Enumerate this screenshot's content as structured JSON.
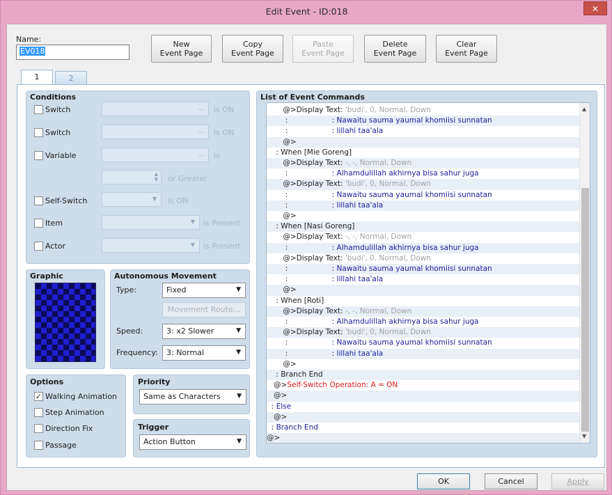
{
  "window": {
    "title": "Edit Event - ID:018",
    "close_glyph": "✕"
  },
  "name": {
    "label": "Name:",
    "value": "EV018"
  },
  "toolbar": {
    "new_page": "New\nEvent Page",
    "copy_page": "Copy\nEvent Page",
    "paste_page": "Paste\nEvent Page",
    "delete_page": "Delete\nEvent Page",
    "clear_page": "Clear\nEvent Page"
  },
  "tabs": [
    {
      "label": "1",
      "active": true
    },
    {
      "label": "2",
      "active": false
    }
  ],
  "conditions": {
    "title": "Conditions",
    "switch1": {
      "label": "Switch",
      "suffix": "is ON",
      "checked": false
    },
    "switch2": {
      "label": "Switch",
      "suffix": "is ON",
      "checked": false
    },
    "variable": {
      "label": "Variable",
      "suffix": "is",
      "suffix2": "or Greater",
      "checked": false
    },
    "self_switch": {
      "label": "Self-Switch",
      "suffix": "is ON",
      "checked": false
    },
    "item": {
      "label": "Item",
      "suffix": "is Present",
      "checked": false
    },
    "actor": {
      "label": "Actor",
      "suffix": "is Present",
      "checked": false
    },
    "dots": "...",
    "arrow": "▼",
    "spin_up": "▲",
    "spin_down": "▼"
  },
  "graphic": {
    "title": "Graphic"
  },
  "movement": {
    "title": "Autonomous Movement",
    "type_label": "Type:",
    "type_value": "Fixed",
    "route_button": "Movement Route...",
    "speed_label": "Speed:",
    "speed_value": "3: x2 Slower",
    "frequency_label": "Frequency:",
    "frequency_value": "3: Normal"
  },
  "options": {
    "title": "Options",
    "items": [
      {
        "label": "Walking Animation",
        "checked": true
      },
      {
        "label": "Step Animation",
        "checked": false
      },
      {
        "label": "Direction Fix",
        "checked": false
      },
      {
        "label": "Passage",
        "checked": false
      }
    ],
    "check_glyph": "✓"
  },
  "priority": {
    "title": "Priority",
    "value": "Same as Characters"
  },
  "trigger": {
    "title": "Trigger",
    "value": "Action Button"
  },
  "commands": {
    "title": "List of Event Commands",
    "scroll_up": "▲",
    "scroll_down": "▼",
    "lines": [
      [
        [
          "       @>Display Text: ",
          ""
        ],
        [
          "'budi', 0, Normal, Down",
          "c-gray"
        ]
      ],
      [
        [
          "        :                   ",
          ""
        ],
        [
          ": Nawaitu sauma yaumal khomiisi sunnatan",
          "c-blue"
        ]
      ],
      [
        [
          "        :                   ",
          ""
        ],
        [
          ": lillahi taa'ala",
          "c-blue"
        ]
      ],
      [
        [
          "       @>",
          ""
        ]
      ],
      [
        [
          "    : When [Mie Goreng]",
          ""
        ]
      ],
      [
        [
          "       @>Display Text: ",
          ""
        ],
        [
          "-, -, Normal, Down",
          "c-gray"
        ]
      ],
      [
        [
          "        :                   ",
          ""
        ],
        [
          ": Alhamdulillah akhirnya bisa sahur juga",
          "c-blue"
        ]
      ],
      [
        [
          "       @>Display Text: ",
          ""
        ],
        [
          "'budi', 0, Normal, Down",
          "c-gray"
        ]
      ],
      [
        [
          "        :                   ",
          ""
        ],
        [
          ": Nawaitu sauma yaumal khomiisi sunnatan",
          "c-blue"
        ]
      ],
      [
        [
          "        :                   ",
          ""
        ],
        [
          ": lillahi taa'ala",
          "c-blue"
        ]
      ],
      [
        [
          "       @>",
          ""
        ]
      ],
      [
        [
          "    : When [Nasi Goreng]",
          ""
        ]
      ],
      [
        [
          "       @>Display Text: ",
          ""
        ],
        [
          "-, -, Normal, Down",
          "c-gray"
        ]
      ],
      [
        [
          "        :                   ",
          ""
        ],
        [
          ": Alhamdulillah akhirnya bisa sahur juga",
          "c-blue"
        ]
      ],
      [
        [
          "       @>Display Text: ",
          ""
        ],
        [
          "'budi', 0, Normal, Down",
          "c-gray"
        ]
      ],
      [
        [
          "        :                   ",
          ""
        ],
        [
          ": Nawaitu sauma yaumal khomiisi sunnatan",
          "c-blue"
        ]
      ],
      [
        [
          "        :                   ",
          ""
        ],
        [
          ": lillahi taa'ala",
          "c-blue"
        ]
      ],
      [
        [
          "       @>",
          ""
        ]
      ],
      [
        [
          "    : When [Roti]",
          ""
        ]
      ],
      [
        [
          "       @>Display Text: ",
          ""
        ],
        [
          "-, -, Normal, Down",
          "c-gray"
        ]
      ],
      [
        [
          "        :                   ",
          ""
        ],
        [
          ": Alhamdulillah akhirnya bisa sahur juga",
          "c-blue"
        ]
      ],
      [
        [
          "       @>Display Text: ",
          ""
        ],
        [
          "'budi', 0, Normal, Down",
          "c-gray"
        ]
      ],
      [
        [
          "        :                   ",
          ""
        ],
        [
          ": Nawaitu sauma yaumal khomiisi sunnatan",
          "c-blue"
        ]
      ],
      [
        [
          "        :                   ",
          ""
        ],
        [
          ": lillahi taa'ala",
          "c-blue"
        ]
      ],
      [
        [
          "       @>",
          ""
        ]
      ],
      [
        [
          "    : Branch End",
          ""
        ]
      ],
      [
        [
          "   @>",
          ""
        ],
        [
          "Self-Switch Operation: A = ON",
          "c-red"
        ]
      ],
      [
        [
          "   @>",
          ""
        ]
      ],
      [
        [
          "  : ",
          ""
        ],
        [
          "Else",
          "c-blue"
        ]
      ],
      [
        [
          "   @>",
          ""
        ]
      ],
      [
        [
          "  : ",
          ""
        ],
        [
          "Branch End",
          "c-blue"
        ]
      ],
      [
        [
          "@>",
          ""
        ]
      ]
    ]
  },
  "footer": {
    "ok": "OK",
    "cancel": "Cancel",
    "apply": "Apply"
  },
  "colors": {
    "accent": "#e9a7c6",
    "group_bg": "#cfdcea",
    "command_blue": "#1d1d9d",
    "command_red": "#e01818"
  }
}
